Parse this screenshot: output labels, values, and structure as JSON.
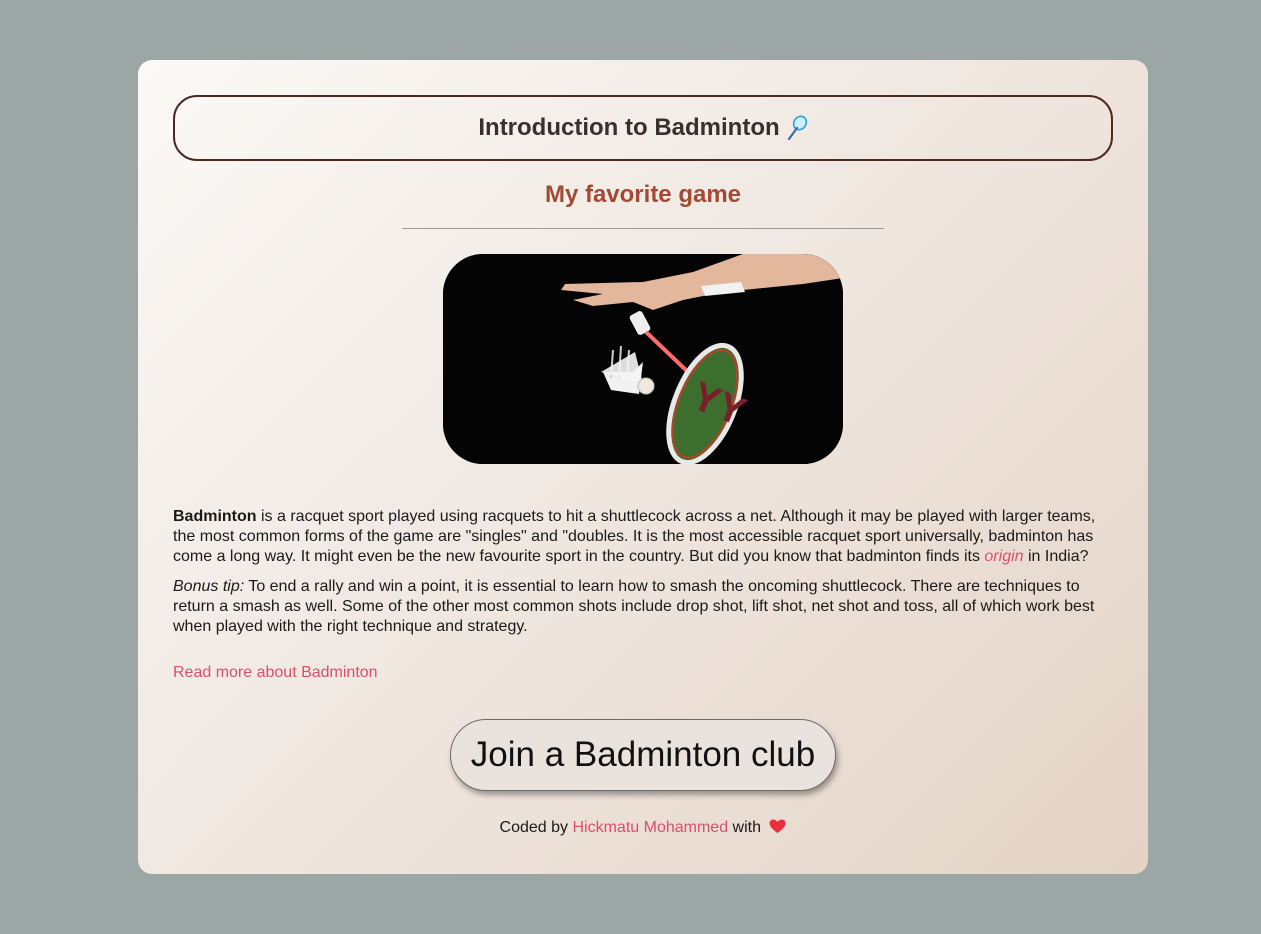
{
  "header": {
    "title": "Introduction to Badminton",
    "title_icon": "badminton-racket-icon"
  },
  "subtitle": "My favorite game",
  "image": {
    "description_icon": "badminton-smash-photo"
  },
  "intro": {
    "bold_word": "Badminton",
    "text_before_link": " is a racquet sport played using racquets to hit a shuttlecock across a net. Although it may be played with larger teams, the most common forms of the game are \"singles\" and \"doubles. It is the most accessible racquet sport universally, badminton has come a long way. It might even be the new favourite sport in the country. But did you know that badminton finds its ",
    "link_text": "origin",
    "text_after_link": " in India?"
  },
  "tip": {
    "label": "Bonus tip:",
    "text": " To end a rally and win a point, it is essential to learn how to smash the oncoming shuttlecock. There are techniques to return a smash as well. Some of the other most common shots include drop shot, lift shot, net shot and toss, all of which work best when played with the right technique and strategy."
  },
  "read_more_link": "Read more about Badminton",
  "join_button": "Join a Badminton club",
  "footer": {
    "prefix": "Coded by ",
    "author": "Hickmatu Mohammed",
    "suffix": " with",
    "icon": "heart-icon"
  },
  "colors": {
    "background": "#9ba6a5",
    "accent_link": "#d9506a",
    "subtitle": "#a24a33",
    "title_border": "#4b2a22"
  }
}
